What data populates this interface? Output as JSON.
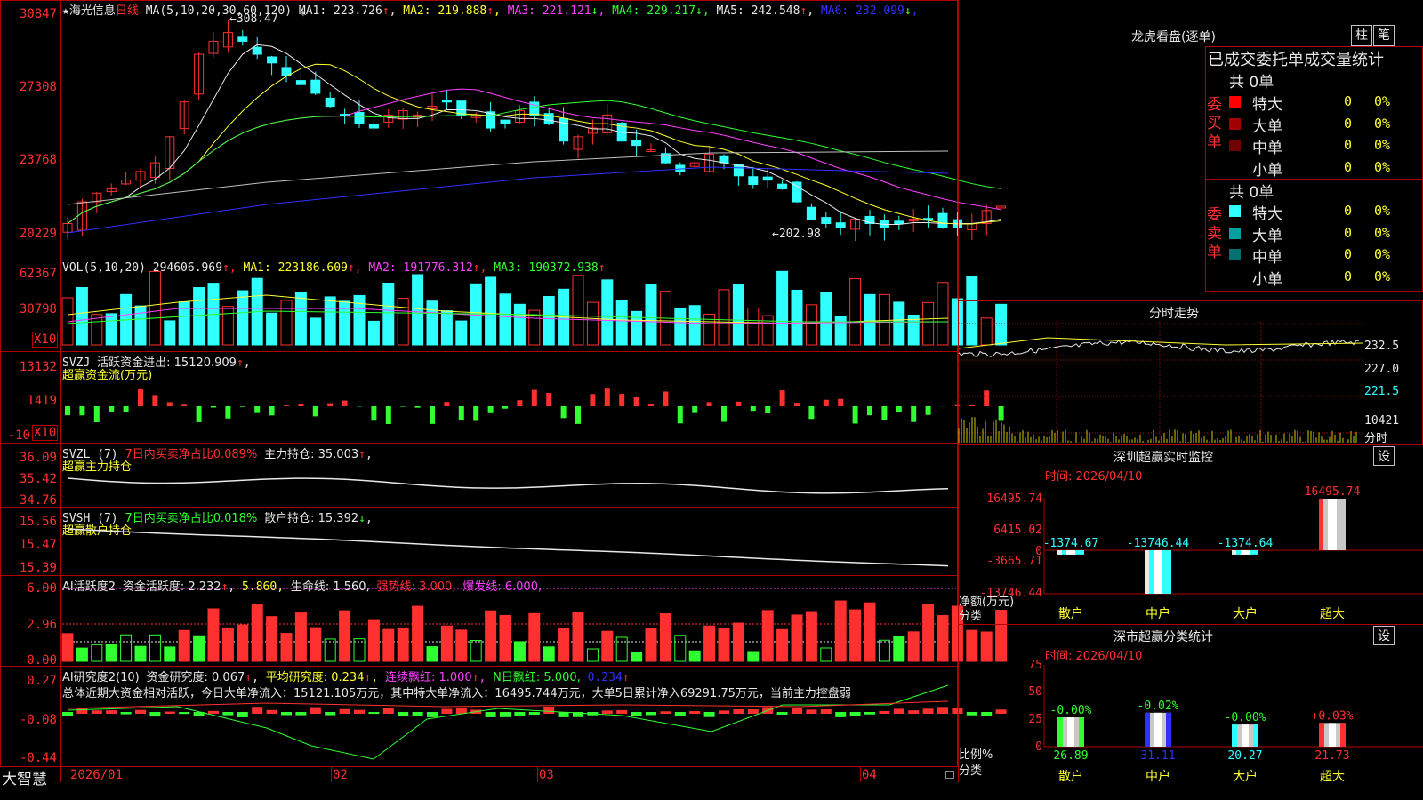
{
  "stock": {
    "star": "★",
    "name": "海光信息",
    "period": "日线"
  },
  "main_chart": {
    "ma_label": "MA(5,10,20,30,60,120)",
    "ma": [
      {
        "name": "MA1:",
        "value": "223.726",
        "arrow": "↑",
        "color": "#e8e8e8"
      },
      {
        "name": "MA2:",
        "value": "219.888",
        "arrow": "↑",
        "color": "#ffff30"
      },
      {
        "name": "MA3:",
        "value": "221.121",
        "arrow": "↓",
        "color": "#ff40ff"
      },
      {
        "name": "MA4:",
        "value": "229.217",
        "arrow": "↓",
        "color": "#30ff30"
      },
      {
        "name": "MA5:",
        "value": "242.548",
        "arrow": "↑",
        "color": "#e8e8e8"
      },
      {
        "name": "MA6:",
        "value": "232.099",
        "arrow": "↓",
        "color": "#3030ff"
      }
    ],
    "y_ticks": [
      "30847",
      "27308",
      "23768",
      "20229"
    ],
    "high_label": "←308.47",
    "low_label": "←202.98",
    "marker": "*"
  },
  "vol_panel": {
    "label": "VOL(5,10,20)",
    "v": "294606.969",
    "ma1": "MA1: 223186.609",
    "ma2": "MA2: 191776.312",
    "ma3": "MA3: 190372.938",
    "y_ticks": [
      "62367",
      "30798"
    ],
    "unit": "X10"
  },
  "svzj_panel": {
    "label": "SVZJ",
    "text1": "活跃资金进出: 15120.909",
    "text2": "超赢资金流(万元)",
    "y_ticks": [
      "13132",
      "1419",
      "-10"
    ],
    "unit": "X10"
  },
  "svzl_panel": {
    "label": "SVZL (7)",
    "text1": "7日内买卖净占比0.089%",
    "text2": "主力持仓: 35.003",
    "text3": "超赢主力持仓",
    "y_ticks": [
      "36.09",
      "35.42",
      "34.76"
    ]
  },
  "svsh_panel": {
    "label": "SVSH (7)",
    "text1": "7日内买卖净占比0.018%",
    "text2": "散户持仓: 15.392",
    "text3": "超赢散户持仓",
    "y_ticks": [
      "15.56",
      "15.47",
      "15.39"
    ]
  },
  "ai_active": {
    "label": "AI活跃度2",
    "t1": "资金活跃度: 2.232",
    "t2": "5.860",
    "t3": "生命线: 1.560,",
    "t4": "强势线: 3.000,",
    "t5": "爆发线: 6.000,",
    "y_ticks": [
      "6.00",
      "2.96",
      "0.00"
    ]
  },
  "ai_research": {
    "label": "AI研究度2(10)",
    "t1": "资金研究度: 0.067",
    "t2": "平均研究度: 0.234",
    "t3": "连续飘红: 1.000",
    "t4": "N日飘红: 5.000,",
    "t5": "0.234",
    "summary": "总体近期大资金相对活跃，今日大单净流入：15121.105万元，其中特大单净流入：16495.744万元，大单5日累计净入69291.75万元，当前主力控盘弱",
    "y_ticks": [
      "0.27",
      "-0.08",
      "-0.44"
    ]
  },
  "x_axis": {
    "labels": [
      "2026/01",
      "02",
      "03",
      "04"
    ],
    "brand": "大智慧"
  },
  "right": {
    "lhb_title": "龙虎看盘(逐单)",
    "btn1": "柱",
    "btn2": "笔",
    "header": "已成交委托单成交量统计",
    "buy": {
      "side": "委买单",
      "total": "共 0单",
      "rows": [
        {
          "label": "特大",
          "n": "0",
          "p": "0%",
          "color": "#ff0000"
        },
        {
          "label": "大单",
          "n": "0",
          "p": "0%",
          "color": "#a00000"
        },
        {
          "label": "中单",
          "n": "0",
          "p": "0%",
          "color": "#700000"
        },
        {
          "label": "小单",
          "n": "0",
          "p": "0%",
          "color": "#000000"
        }
      ]
    },
    "sell": {
      "side": "委卖单",
      "total": "共 0单",
      "rows": [
        {
          "label": "特大",
          "n": "0",
          "p": "0%",
          "color": "#30ffff"
        },
        {
          "label": "大单",
          "n": "0",
          "p": "0%",
          "color": "#00a0a0"
        },
        {
          "label": "中单",
          "n": "0",
          "p": "0%",
          "color": "#007070"
        },
        {
          "label": "小单",
          "n": "0",
          "p": "0%",
          "color": "#000000"
        }
      ]
    },
    "fs_title": "分时走势",
    "fs_ticks": [
      "232.5",
      "227.0",
      "221.5",
      "10421"
    ],
    "fs_unit": "分时",
    "sz_title": "深圳超赢实时监控",
    "sz_btn": "设",
    "sz_time": "时间: 2026/04/10",
    "sz_ticks": [
      "16495.74",
      "6415.02",
      "0",
      "-3665.71",
      "-13746.44"
    ],
    "sz_ylabel": "净额(万元)",
    "sz_xlabel": "分类",
    "sz_cats": [
      "散户",
      "中户",
      "大户",
      "超大"
    ],
    "sz_values": [
      -1374.67,
      -13746.44,
      -1374.64,
      16495.74
    ],
    "sz_value_labels": [
      "-1374.67",
      "-13746.44",
      "-1374.64",
      "16495.74"
    ],
    "fl_title": "深市超赢分类统计",
    "fl_btn": "设",
    "fl_time": "时间: 2026/04/10",
    "fl_ticks": [
      "75",
      "50",
      "25",
      "0"
    ],
    "fl_ylabel": "比例%",
    "fl_xlabel": "分类",
    "fl_cats": [
      "散户",
      "中户",
      "大户",
      "超大"
    ],
    "fl_values": [
      26.89,
      31.11,
      20.27,
      21.73
    ],
    "fl_changes": [
      "-0.00%",
      "-0.02%",
      "-0.00%",
      "+0.03%"
    ],
    "fl_colors": [
      "#30ff30",
      "#3030ff",
      "#30ffff",
      "#ff3030"
    ]
  },
  "chart_data": {
    "type": "bar",
    "title": "深圳超赢实时监控",
    "categories": [
      "散户",
      "中户",
      "大户",
      "超大"
    ],
    "values": [
      -1374.67,
      -13746.44,
      -1374.64,
      16495.74
    ],
    "ylim": [
      -13746.44,
      16495.74
    ],
    "ylabel": "净额(万元)",
    "xlabel": "分类"
  }
}
